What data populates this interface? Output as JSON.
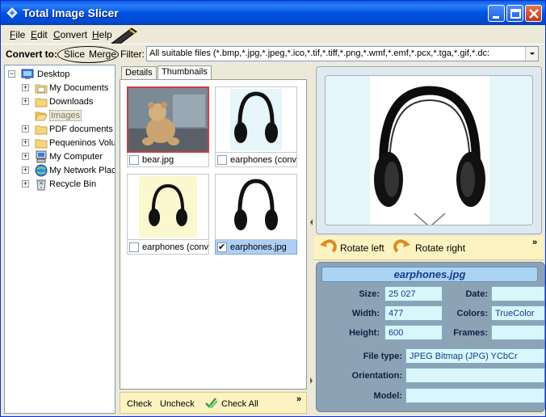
{
  "window": {
    "title": "Total Image Slicer",
    "accent": "#0054e3"
  },
  "menu": [
    {
      "label": "File",
      "u": "F",
      "rest": "ile"
    },
    {
      "label": "Edit",
      "u": "E",
      "rest": "dit"
    },
    {
      "label": "Convert",
      "u": "C",
      "rest": "onvert"
    },
    {
      "label": "Help",
      "u": "H",
      "rest": "elp"
    }
  ],
  "toolbar": {
    "convert_label": "Convert to:",
    "slice": "Slice",
    "merge": "Merge",
    "filter_label": "Filter:",
    "filter_value": "All suitable files (*.bmp,*.jpg,*.jpeg,*.ico,*.tif,*.tiff,*.png,*.wmf,*.emf,*.pcx,*.tga,*.gif,*.dc:"
  },
  "tree": [
    {
      "label": "Desktop",
      "icon": "desktop-icon",
      "expander": "minus"
    },
    {
      "label": "My Documents",
      "icon": "folder-icon",
      "expander": "plus"
    },
    {
      "label": "Downloads",
      "icon": "folder-icon",
      "expander": "plus"
    },
    {
      "label": "Images",
      "icon": "folder-open-icon",
      "expander": "none",
      "selected": true
    },
    {
      "label": "PDF documents",
      "icon": "folder-icon",
      "expander": "plus"
    },
    {
      "label": "Pequeninos Volu",
      "icon": "folder-icon",
      "expander": "plus"
    },
    {
      "label": "My Computer",
      "icon": "computer-icon",
      "expander": "plus"
    },
    {
      "label": "My Network Plac",
      "icon": "network-icon",
      "expander": "plus"
    },
    {
      "label": "Recycle Bin",
      "icon": "recycle-bin-icon",
      "expander": "plus"
    }
  ],
  "tabs": {
    "details": "Details",
    "thumbnails": "Thumbnails"
  },
  "thumbnails": [
    {
      "caption": "bear.jpg",
      "checked": false
    },
    {
      "caption": "earphones (conv",
      "checked": false
    },
    {
      "caption": "earphones (conv",
      "checked": false
    },
    {
      "caption": "earphones.jpg",
      "checked": true
    }
  ],
  "bottom": {
    "check": "Check",
    "uncheck": "Uncheck",
    "check_all": "Check All",
    "more": "»"
  },
  "rotate": {
    "left": "Rotate left",
    "right": "Rotate right",
    "more": "»"
  },
  "info": {
    "title": "earphones.jpg",
    "size_label": "Size:",
    "size": "25 027",
    "date_label": "Date:",
    "date": "",
    "width_label": "Width:",
    "width": "477",
    "colors_label": "Colors:",
    "colors": "TrueColor",
    "height_label": "Height:",
    "height": "600",
    "frames_label": "Frames:",
    "frames": "",
    "filetype_label": "File type:",
    "filetype": "JPEG Bitmap (JPG) YCbCr",
    "orientation_label": "Orientation:",
    "orientation": "",
    "model_label": "Model:",
    "model": ""
  }
}
